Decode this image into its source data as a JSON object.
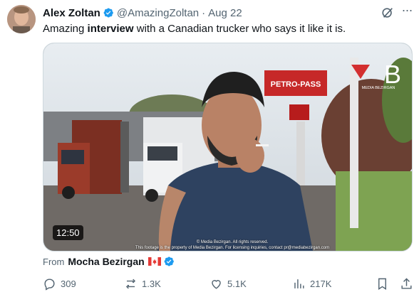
{
  "tweet": {
    "author_name": "Alex Zoltan",
    "handle": "@AmazingZoltan",
    "separator": "·",
    "date": "Aug 22",
    "text_before": "Amazing ",
    "text_bold": "interview",
    "text_after": " with a Canadian trucker who says it like it is."
  },
  "media": {
    "duration": "12:50",
    "watermark": "MEDIA BEZIRGAN",
    "sign_text": "PETRO-PASS",
    "copyright_line1": "© Media Bezirgan. All rights reserved.",
    "copyright_line2": "This footage is the property of Media Bezirgan. For licensing inquiries, contact pr@mediabezirgan.com"
  },
  "attribution": {
    "prefix": "From",
    "source_name": "Mocha Bezirgan"
  },
  "actions": {
    "replies": "309",
    "reposts": "1.3K",
    "likes": "5.1K",
    "views": "217K"
  },
  "colors": {
    "verified": "#1d9bf0",
    "muted": "#536471",
    "text": "#0f1419"
  }
}
